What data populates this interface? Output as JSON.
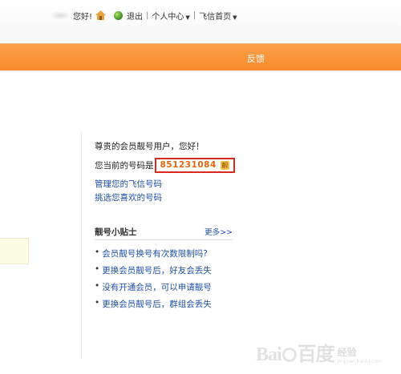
{
  "header": {
    "greeting": "您好!",
    "logout": "退出",
    "sep": "|",
    "personal_center": "个人中心",
    "fetion_home": "飞信首页",
    "caret": "▼"
  },
  "banner": {
    "feedback": "反馈"
  },
  "main": {
    "greeting": "尊贵的会员靓号用户，您好！",
    "current_number_label": "您当前的号码是",
    "current_number": "851231084",
    "liang_badge": "靓",
    "manage_link": "管理您的飞信号码",
    "choose_link": "挑选您喜欢的号码"
  },
  "tips": {
    "title": "靓号小贴士",
    "more": "更多>>",
    "bullet": "•",
    "items": [
      "会员靓号换号有次数限制吗?",
      "更换会员靓号后，好友会丢失",
      "没有开通会员，可以申请靓号",
      "更换会员靓号后，群组会丢失"
    ]
  },
  "watermark": {
    "logo_left": "Bai",
    "logo_right": "百度",
    "cn": "经验",
    "url": "jingyan.baidu.com"
  },
  "colors": {
    "orange_bar": "#f7892b",
    "link_blue": "#1f4fa5",
    "highlight_red": "#d9281e",
    "number_orange": "#e2650f"
  }
}
